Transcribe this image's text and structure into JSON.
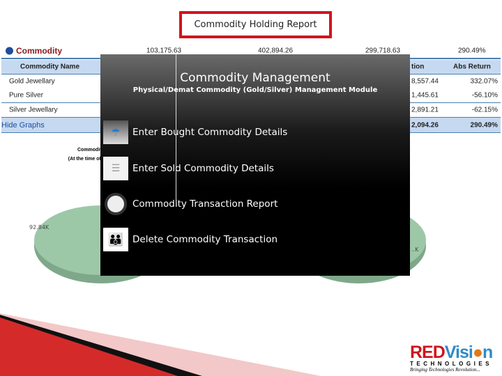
{
  "slide_title": "Commodity Holding Report",
  "table": {
    "group_label": "Commodity",
    "group_totals": [
      "103,175.63",
      "402,894.26",
      "299,718.63",
      "290.49%"
    ],
    "columns": [
      "Commodity Name",
      "tion",
      "Abs Return"
    ],
    "rows": [
      {
        "name": "Gold Jewellary",
        "valuation": "8,557.44",
        "abs_return": "332.07%"
      },
      {
        "name": "Pure Silver",
        "valuation": "1,445.61",
        "abs_return": "-56.10%"
      },
      {
        "name": "Silver Jewellary",
        "valuation": "2,891.21",
        "abs_return": "-62.15%"
      }
    ],
    "footer": {
      "label": "Hide Graphs",
      "valuation": "2,094.26",
      "abs_return": "290.49%"
    }
  },
  "chart": {
    "title_partial": "Commodit",
    "subtitle_partial": "(At the time of",
    "left_label": "92.84K",
    "right_label": "..K",
    "pie_color": "#9dc8a8"
  },
  "overlay": {
    "title": "Commodity Management",
    "subtitle": "Physical/Demat Commodity (Gold/Silver) Management Module",
    "items": [
      {
        "label": "Enter Bought Commodity Details",
        "icon": "umbrella-people-icon"
      },
      {
        "label": "Enter Sold Commodity Details",
        "icon": "list-icon"
      },
      {
        "label": "Commodity Transaction Report",
        "icon": "clock-icon"
      },
      {
        "label": "Delete Commodity Transaction",
        "icon": "family-icon"
      }
    ]
  },
  "logo": {
    "brand_red": "RED",
    "brand_blue": "Visi",
    "brand_end": "n",
    "sub": "TECHNOLOGIES",
    "tagline": "Bringing Technologies Revolution..."
  },
  "colors": {
    "accent_red": "#d0141e",
    "header_blue": "#c5d9f1",
    "logo_blue": "#2e8bc9"
  }
}
